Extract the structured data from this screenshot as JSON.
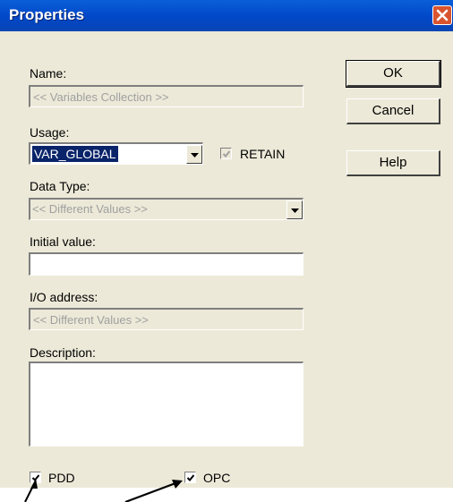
{
  "window": {
    "title": "Properties"
  },
  "fields": {
    "name_label": "Name:",
    "name_value": "<< Variables Collection >>",
    "usage_label": "Usage:",
    "usage_value": "VAR_GLOBAL",
    "retain_label": "RETAIN",
    "retain_checked": true,
    "datatype_label": "Data Type:",
    "datatype_value": "<< Different Values >>",
    "initial_label": "Initial value:",
    "initial_value": "",
    "io_label": "I/O address:",
    "io_value": "<< Different Values >>",
    "description_label": "Description:",
    "description_value": ""
  },
  "checkboxes": {
    "pdd_label": "PDD",
    "pdd_checked": true,
    "opc_label": "OPC",
    "opc_checked": true
  },
  "buttons": {
    "ok": "OK",
    "cancel": "Cancel",
    "help": "Help"
  },
  "colors": {
    "titlebar": "#0047c8",
    "close_button": "#d9542f",
    "dialog_bg": "#ece9d8",
    "selection": "#0a246a"
  }
}
